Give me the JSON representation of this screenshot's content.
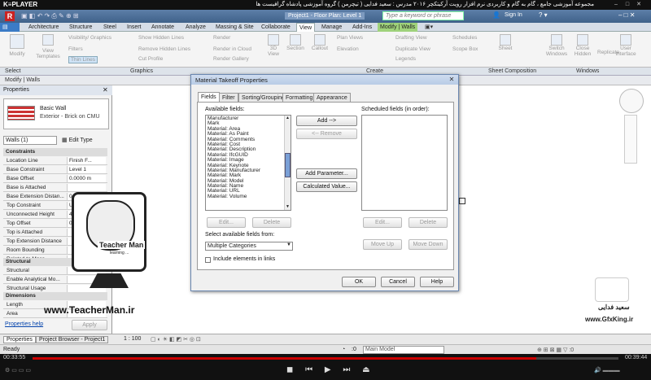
{
  "player": {
    "logo": "K≡PLAYER",
    "title": "مجموعه آموزشی جامع ، گام به گام و کاربردی نرم افزار رویت آرکیتکچر ۲۰۱۶  مدرس : سعید فدایی ( تیچرمن ) گروه آموزشی پادشاه گرافیست ها",
    "time_elapsed": "00:33:55",
    "time_total": "00:39:44",
    "progress": 0.86
  },
  "revit": {
    "document_title": "Project1 - Floor Plan: Level 1",
    "search_placeholder": "Type a keyword or phrase",
    "sign_in": "Sign In",
    "tabs": [
      "Architecture",
      "Structure",
      "Steel",
      "Insert",
      "Annotate",
      "Analyze",
      "Massing & Site",
      "Collaborate",
      "View",
      "Manage",
      "Add-Ins",
      "Modify | Walls"
    ],
    "active_tab": "View",
    "ribbon": {
      "modify": "Modify",
      "view_templates": "View Templates",
      "visibility": "Visibility/ Graphics",
      "filters": "Filters",
      "thin_lines": "Thin  Lines",
      "show_hidden": "Show  Hidden Lines",
      "remove_hidden": "Remove  Hidden Lines",
      "cut_profile": "Cut  Profile",
      "render": "Render",
      "render_cloud": "Render  in Cloud",
      "render_gallery": "Render  Gallery",
      "view3d": "3D View",
      "section": "Section",
      "callout": "Callout",
      "plan_views": "Plan  Views",
      "elevation": "Elevation",
      "drafting_view": "Drafting  View",
      "duplicate_view": "Duplicate View",
      "legends": "Legends",
      "schedules": "Schedules",
      "scope_box": "Scope  Box",
      "sheet": "Sheet",
      "switch_windows": "Switch Windows",
      "close_hidden": "Close Hidden",
      "replicate": "Replicate",
      "user_interface": "User Interface"
    },
    "panels": [
      "Select",
      "Graphics",
      "Create",
      "Sheet Composition",
      "Windows"
    ],
    "modify_bar": "Modify | Walls",
    "properties": {
      "header": "Properties",
      "family": "Basic Wall",
      "type": "Exterior - Brick on CMU",
      "selector": "Walls (1)",
      "edit_type": "Edit Type",
      "sections": {
        "constraints": "Constraints",
        "structural": "Structural",
        "dimensions": "Dimensions"
      },
      "rows": [
        {
          "k": "Location Line",
          "v": "Finish F..."
        },
        {
          "k": "Base Constraint",
          "v": "Level 1"
        },
        {
          "k": "Base Offset",
          "v": "0.0000 m"
        },
        {
          "k": "Base is Attached",
          "v": ""
        },
        {
          "k": "Base Extension Distan...",
          "v": "0.0000 m"
        },
        {
          "k": "Top Constraint",
          "v": "Up to le..."
        },
        {
          "k": "Unconnected Height",
          "v": "4.0000 m"
        },
        {
          "k": "Top Offset",
          "v": "0.0000 m"
        },
        {
          "k": "Top is Attached",
          "v": ""
        },
        {
          "k": "Top Extension Distance",
          "v": ""
        },
        {
          "k": "Room Bounding",
          "v": ""
        },
        {
          "k": "Related to Mass",
          "v": ""
        }
      ],
      "structural_rows": [
        {
          "k": "Structural",
          "v": ""
        },
        {
          "k": "Enable Analytical Mo...",
          "v": ""
        },
        {
          "k": "Structural Usage",
          "v": ""
        }
      ],
      "dimension_rows": [
        {
          "k": "Length",
          "v": ""
        },
        {
          "k": "Area",
          "v": ""
        }
      ],
      "help": "Properties help",
      "apply": "Apply"
    },
    "bottom_tabs": [
      "Properties",
      "Project Browser - Project1"
    ],
    "scale": "1 : 100",
    "status": "Ready",
    "model": "Main Model",
    "zero": ":0"
  },
  "dialog": {
    "title": "Material Takeoff Properties",
    "tabs": [
      "Fields",
      "Filter",
      "Sorting/Grouping",
      "Formatting",
      "Appearance"
    ],
    "available_label": "Available fields:",
    "scheduled_label": "Scheduled fields (in order):",
    "fields": [
      "Manufacturer",
      "Mark",
      "Material: Area",
      "Material: As Paint",
      "Material: Comments",
      "Material: Cost",
      "Material: Description",
      "Material: IfcGUID",
      "Material: Image",
      "Material: Keynote",
      "Material: Manufacturer",
      "Material: Mark",
      "Material: Model",
      "Material: Name",
      "Material: URL",
      "Material: Volume"
    ],
    "add": "Add -->",
    "remove": "<-- Remove",
    "add_parameter": "Add Parameter...",
    "calculated_value": "Calculated Value...",
    "edit": "Edit...",
    "delete": "Delete",
    "select_from_label": "Select available fields from:",
    "select_from_value": "Multiple Categories",
    "include_links": "Include elements in links",
    "move_up": "Move Up",
    "move_down": "Move Down",
    "ok": "OK",
    "cancel": "Cancel",
    "help": "Help"
  },
  "watermark": {
    "site_left": "www.TeacherMan.ir",
    "teacher_name": "Teacher Man",
    "teacher_sub": "learning ...",
    "site_right": "www.GfxKing.ir",
    "persian_name": "سعید فدایی"
  }
}
